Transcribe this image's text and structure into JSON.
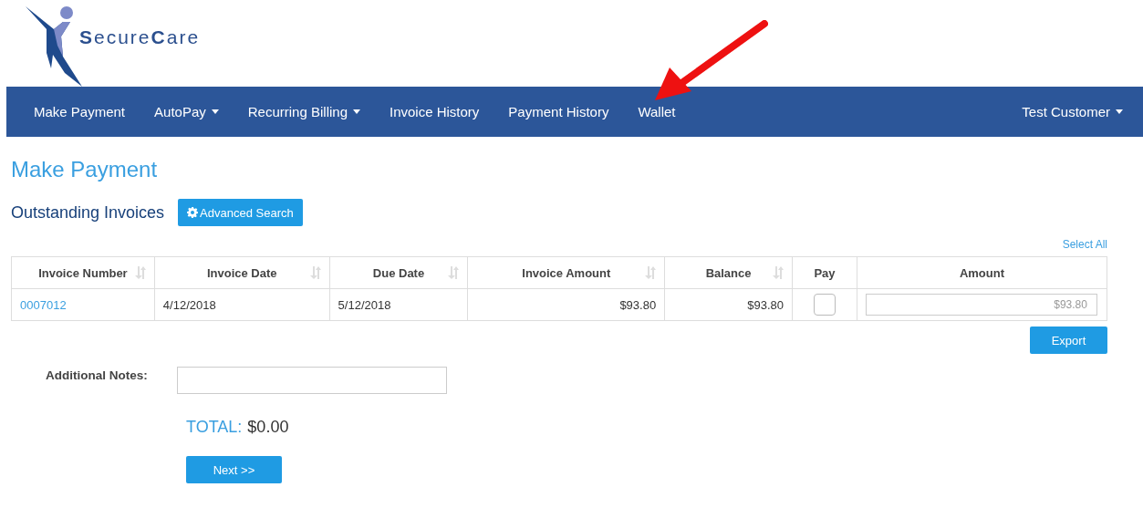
{
  "logo": {
    "text": "**S**ecure**C**are"
  },
  "nav": {
    "items": [
      {
        "label": "Make Payment",
        "dropdown": false
      },
      {
        "label": "AutoPay",
        "dropdown": true
      },
      {
        "label": "Recurring Billing",
        "dropdown": true
      },
      {
        "label": "Invoice History",
        "dropdown": false
      },
      {
        "label": "Payment History",
        "dropdown": false
      },
      {
        "label": "Wallet",
        "dropdown": false
      }
    ],
    "user": {
      "label": "Test Customer",
      "dropdown": true
    }
  },
  "page_title": "Make Payment",
  "section_title": "Outstanding Invoices",
  "advanced_search": "Advanced Search",
  "select_all": "Select All",
  "table": {
    "columns": [
      {
        "label": "Invoice Number",
        "sortable": true
      },
      {
        "label": "Invoice Date",
        "sortable": true
      },
      {
        "label": "Due Date",
        "sortable": true
      },
      {
        "label": "Invoice Amount",
        "sortable": true
      },
      {
        "label": "Balance",
        "sortable": true
      },
      {
        "label": "Pay",
        "sortable": false
      },
      {
        "label": "Amount",
        "sortable": false
      }
    ],
    "rows": [
      {
        "invoice_number": "0007012",
        "invoice_date": "4/12/2018",
        "due_date": "5/12/2018",
        "invoice_amount": "$93.80",
        "balance": "$93.80",
        "pay": false,
        "amount_placeholder": "$93.80"
      }
    ]
  },
  "export": "Export",
  "notes": {
    "label": "Additional Notes:"
  },
  "total": {
    "label": "TOTAL:",
    "value": "$0.00"
  },
  "next": "Next >>"
}
